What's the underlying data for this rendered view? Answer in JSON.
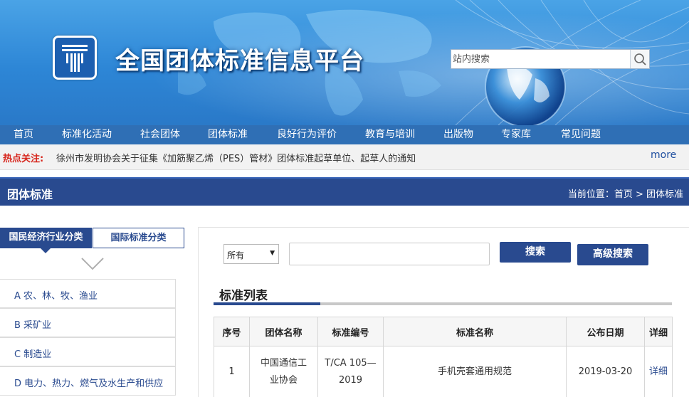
{
  "header": {
    "site_title": "全国团体标准信息平台",
    "search": {
      "placeholder": "站内搜索",
      "button_icon": "search-icon"
    },
    "logo_icon": "platform-logo"
  },
  "nav": {
    "items": [
      "首页",
      "标准化活动",
      "社会团体",
      "团体标准",
      "良好行为评价",
      "教育与培训",
      "出版物",
      "专家库",
      "常见问题"
    ]
  },
  "hotbar": {
    "label": "热点关注:",
    "text": "徐州市发明协会关于征集《加筋聚乙烯（PES）管材》团体标准起草单位、起草人的通知",
    "more": "more"
  },
  "section": {
    "title": "团体标准",
    "breadcrumb": "当前位置：首页 > 团体标准"
  },
  "left": {
    "tabs": [
      "国民经济行业分类",
      "国际标准分类"
    ],
    "active_tab": 0,
    "categories": [
      "A 农、林、牧、渔业",
      "B 采矿业",
      "C 制造业",
      "D 电力、热力、燃气及水生产和供应"
    ]
  },
  "filter": {
    "select_value": "所有",
    "keyword_value": "",
    "search_label": "搜索",
    "advanced_label": "高级搜索"
  },
  "list": {
    "title": "标准列表",
    "columns": [
      "序号",
      "团体名称",
      "标准编号",
      "标准名称",
      "公布日期",
      "详细"
    ],
    "rows": [
      {
        "no": "1",
        "org_line1": "中国通信工",
        "org_line2": "业协会",
        "code_line1": "T/CA 105—",
        "code_line2": "2019",
        "name": "手机壳套通用规范",
        "date": "2019-03-20",
        "detail": "详细"
      }
    ]
  },
  "colors": {
    "primary": "#294a8f",
    "nav": "#2f6fb5",
    "hot": "#d7261d",
    "banner": "#2d86d6"
  }
}
